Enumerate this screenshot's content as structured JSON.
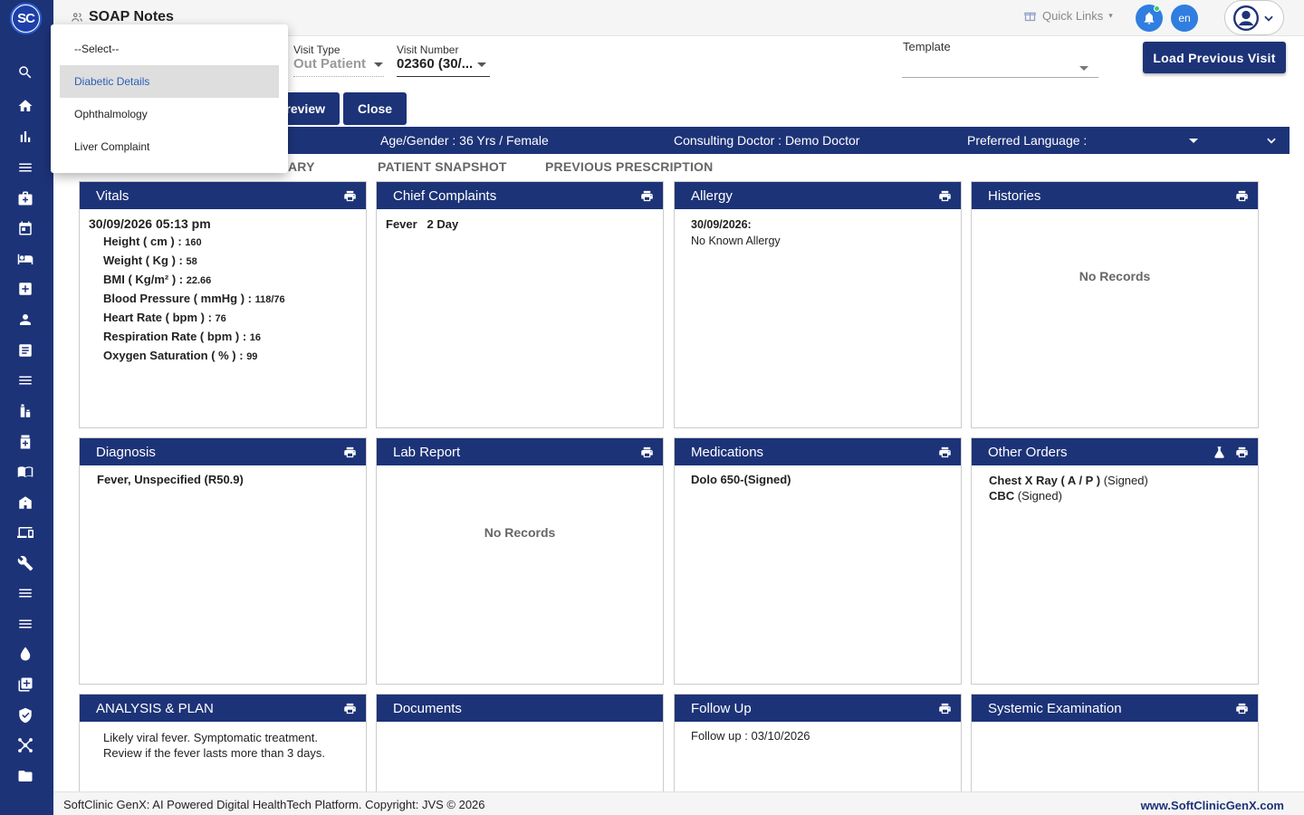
{
  "app": {
    "logo_text": "SC",
    "title": "SOAP Notes"
  },
  "sidebar": {
    "icons": [
      "search-icon",
      "home-icon",
      "bar-chart-icon",
      "menu-icon",
      "medical-kit-icon",
      "calendar-icon",
      "bed-icon",
      "plus-square-icon",
      "user-icon",
      "document-list-icon",
      "menu-icon",
      "pharmacy-icon",
      "medicine-bottle-icon",
      "book-icon",
      "hospital-building-icon",
      "devices-icon",
      "wrench-icon",
      "menu-icon",
      "menu-icon",
      "blood-drop-icon",
      "add-box-icon",
      "shield-icon",
      "network-icon",
      "folder-icon"
    ]
  },
  "topbar": {
    "quick_links": "Quick Links",
    "language": "en"
  },
  "form": {
    "visit_type_label": "Visit Type",
    "visit_type_value": "Out Patient",
    "visit_number_label": "Visit Number",
    "visit_number_value": "02360 (30/...",
    "template_label": "Template",
    "load_previous_visit": "Load Previous Visit",
    "preview_label": "review",
    "close_label": "Close"
  },
  "dropdown": {
    "items": [
      "--Select--",
      "Diabetic Details",
      "Ophthalmology",
      "Liver Complaint"
    ],
    "selected": "Diabetic Details"
  },
  "patient_bar": {
    "age_gender": "Age/Gender :  36 Yrs / Female",
    "consulting_doctor": "Consulting Doctor :  Demo Doctor",
    "preferred_language": "Preferred Language :"
  },
  "tabs": [
    "ARY",
    "PATIENT SNAPSHOT",
    "PREVIOUS PRESCRIPTION"
  ],
  "cards": {
    "vitals": {
      "title": "Vitals",
      "datetime": "30/09/2026 05:13 pm",
      "rows": [
        {
          "label": "Height ( cm ) :",
          "value": "160"
        },
        {
          "label": "Weight ( Kg ) :",
          "value": "58"
        },
        {
          "label": "BMI ( Kg/m² ) :",
          "value": "22.66"
        },
        {
          "label": "Blood Pressure ( mmHg ) :",
          "value": "118/76"
        },
        {
          "label": "Heart Rate ( bpm ) :",
          "value": "76"
        },
        {
          "label": "Respiration Rate ( bpm ) :",
          "value": "16"
        },
        {
          "label": "Oxygen Saturation ( % ) :",
          "value": "99"
        }
      ]
    },
    "chief_complaints": {
      "title": "Chief Complaints",
      "complaint": "Fever",
      "duration": "2 Day"
    },
    "allergy": {
      "title": "Allergy",
      "date": "30/09/2026:",
      "text": "No Known Allergy"
    },
    "histories": {
      "title": "Histories",
      "empty": "No Records"
    },
    "diagnosis": {
      "title": "Diagnosis",
      "text": "Fever, Unspecified (R50.9)"
    },
    "lab_report": {
      "title": "Lab Report",
      "empty": "No Records"
    },
    "medications": {
      "title": "Medications",
      "text": "Dolo 650-(Signed)"
    },
    "other_orders": {
      "title": "Other Orders",
      "items": [
        {
          "name": "Chest X Ray ( A / P )",
          "status": "(Signed)"
        },
        {
          "name": "CBC",
          "status": "(Signed)"
        }
      ]
    },
    "analysis_plan": {
      "title": "ANALYSIS & PLAN",
      "line1": "Likely viral fever. Symptomatic treatment.",
      "line2": "Review if the fever lasts more than 3 days."
    },
    "documents": {
      "title": "Documents"
    },
    "follow_up": {
      "title": "Follow Up",
      "text": "Follow up : 03/10/2026"
    },
    "systemic_examination": {
      "title": "Systemic Examination"
    }
  },
  "footer": {
    "copyright": "SoftClinic GenX: AI Powered Digital HealthTech Platform. Copyright: JVS © 2026",
    "website": "www.SoftClinicGenX.com"
  },
  "colors": {
    "primary": "#1d3378",
    "accent": "#2f7ee0",
    "link": "#2c5fb8"
  }
}
